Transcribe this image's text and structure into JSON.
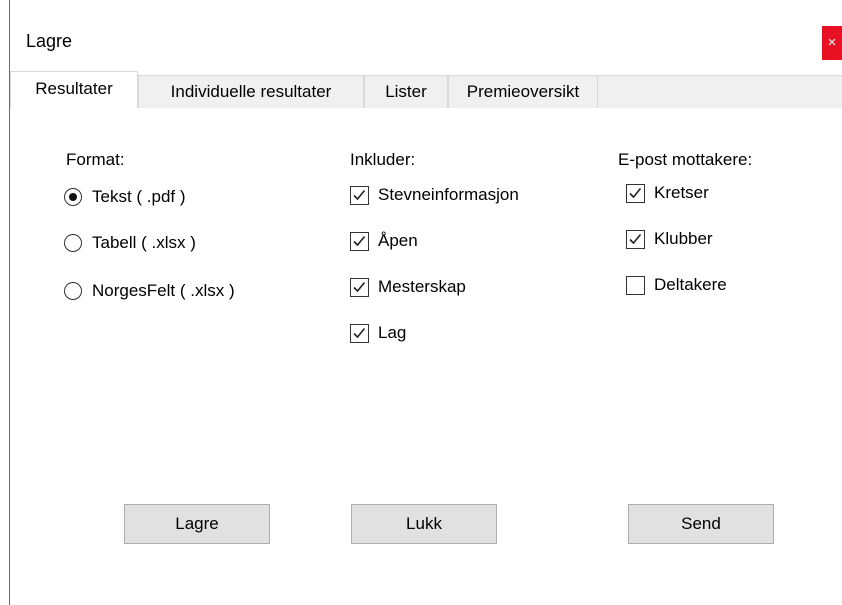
{
  "window": {
    "title": "Lagre",
    "close_glyph": "×",
    "accent_color": "#e81123"
  },
  "tabs": [
    {
      "label": "Resultater",
      "active": true
    },
    {
      "label": "Individuelle resultater",
      "active": false
    },
    {
      "label": "Lister",
      "active": false
    },
    {
      "label": "Premieoversikt",
      "active": false
    }
  ],
  "format": {
    "label": "Format:",
    "options": [
      {
        "label": "Tekst ( .pdf )",
        "selected": true
      },
      {
        "label": "Tabell ( .xlsx )",
        "selected": false
      },
      {
        "label": "NorgesFelt ( .xlsx )",
        "selected": false
      }
    ]
  },
  "include": {
    "label": "Inkluder:",
    "options": [
      {
        "label": "Stevneinformasjon",
        "checked": true
      },
      {
        "label": "Åpen",
        "checked": true
      },
      {
        "label": "Mesterskap",
        "checked": true
      },
      {
        "label": "Lag",
        "checked": true
      }
    ]
  },
  "recipients": {
    "label": "E-post mottakere:",
    "options": [
      {
        "label": "Kretser",
        "checked": true
      },
      {
        "label": "Klubber",
        "checked": true
      },
      {
        "label": "Deltakere",
        "checked": false
      }
    ]
  },
  "buttons": {
    "save": "Lagre",
    "close": "Lukk",
    "send": "Send"
  }
}
